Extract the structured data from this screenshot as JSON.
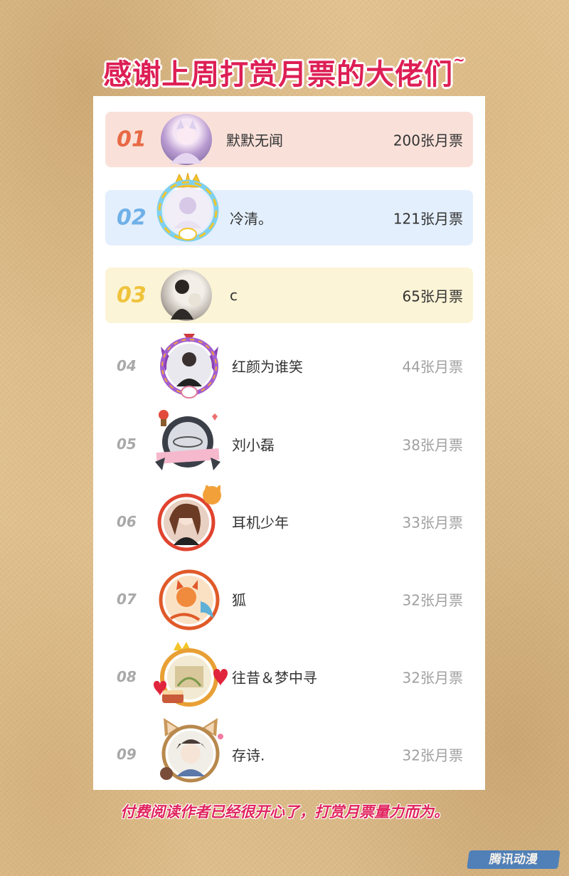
{
  "headline": "感谢上周打赏月票的大佬们",
  "headline_tilde": "~",
  "ranking": [
    {
      "rank": "01",
      "name": "默默无闻",
      "votes": "200张月票",
      "style": "top1"
    },
    {
      "rank": "02",
      "name": "冷清。",
      "votes": "121张月票",
      "style": "top2"
    },
    {
      "rank": "03",
      "name": "c",
      "votes": "65张月票",
      "style": "top3"
    },
    {
      "rank": "04",
      "name": "红颜为谁笑",
      "votes": "44张月票",
      "style": "plain"
    },
    {
      "rank": "05",
      "name": "刘小磊",
      "votes": "38张月票",
      "style": "plain"
    },
    {
      "rank": "06",
      "name": "耳机少年",
      "votes": "33张月票",
      "style": "plain"
    },
    {
      "rank": "07",
      "name": "狐",
      "votes": "32张月票",
      "style": "plain"
    },
    {
      "rank": "08",
      "name": "往昔＆梦中寻",
      "votes": "32张月票",
      "style": "plain"
    },
    {
      "rank": "09",
      "name": "存诗.",
      "votes": "32张月票",
      "style": "plain"
    }
  ],
  "footer": "付费阅读作者已经很开心了，打赏月票量力而为。",
  "watermark": "腾讯动漫",
  "colors": {
    "headline": "#dd1f55",
    "rank1": "#e86945",
    "rank2": "#6fb0e8",
    "rank3": "#efc33c"
  }
}
